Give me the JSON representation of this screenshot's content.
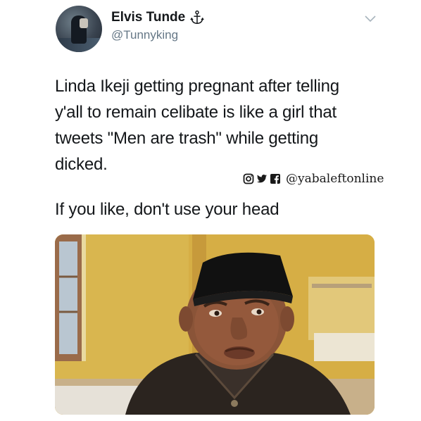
{
  "tweet": {
    "author": {
      "display_name": "Elvis Tunde",
      "handle": "@Tunnyking",
      "badge_icon": "anchor-icon"
    },
    "menu_icon": "chevron-down-icon",
    "text": "Linda Ikeji getting pregnant after telling\ny'all to remain celibate is like a girl that\ntweets \"Men are trash\" while getting\ndicked.",
    "reply_text": "If you like, don't use your head",
    "media": {
      "description_icon": "photo-man-in-cap"
    }
  },
  "watermark": {
    "icons": [
      "instagram-icon",
      "twitter-icon",
      "facebook-icon"
    ],
    "handle": "@yabaleftonline"
  },
  "colors": {
    "text": "#14171a",
    "secondary": "#657786",
    "background": "#ffffff"
  }
}
